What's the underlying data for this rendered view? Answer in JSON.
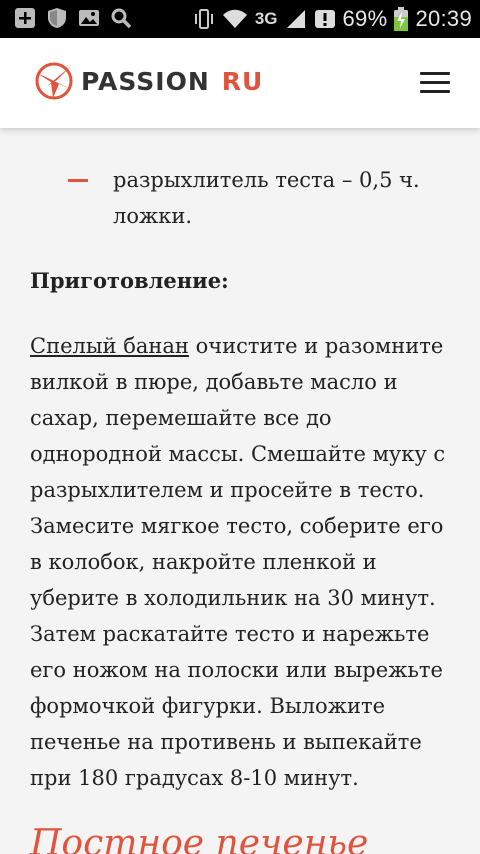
{
  "status_bar": {
    "battery_percent": "69%",
    "time": "20:39",
    "network_label": "3G",
    "icons": [
      "add-icon",
      "shield-icon",
      "image-icon",
      "search-icon",
      "vibrate-icon",
      "wifi-icon",
      "signal-icon",
      "alert-icon",
      "battery-charging-icon"
    ]
  },
  "header": {
    "logo_text_1": "PASSION",
    "logo_text_2": "RU",
    "brand_color": "#e0533c",
    "menu_icon": "hamburger-menu-icon"
  },
  "article": {
    "list_item_text": "разрыхлитель теста – 0,5 ч. ложки.",
    "heading": "Приготовление:",
    "paragraph_link": "Спелый банан",
    "paragraph_text": " очистите и разомните вилкой в пюре, добавьте масло и сахар, перемешайте все до однородной массы. Смешайте муку с разрыхлителем и просейте в тесто. Замесите мягкое тесто, соберите его в колобок, накройте пленкой и уберите в холодильник на 30 минут. Затем раскатайте тесто и нарежьте его ножом на полоски или вырежьте формочкой фигурки. Выложите печенье на противень и выпекайте при 180 градусах 8-10 минут.",
    "next_section_title": "Постное печенье"
  }
}
